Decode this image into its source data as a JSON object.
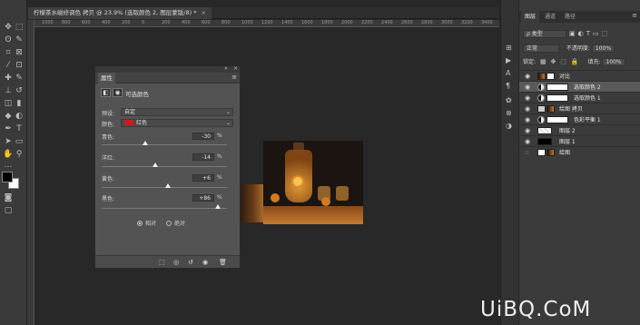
{
  "document": {
    "tab_title": "柠檬茶水磁修调色 拷贝 @ 23.9% (选取颜色 2, 图层蒙版/8) *",
    "close_glyph": "×"
  },
  "ruler": {
    "ticks": [
      "1000",
      "800",
      "600",
      "400",
      "200",
      "0",
      "200",
      "400",
      "600",
      "800",
      "1000",
      "1200",
      "1400",
      "1600",
      "1800",
      "2000",
      "2200",
      "2400",
      "2600",
      "2800",
      "3000",
      "3200",
      "3400",
      "3600"
    ]
  },
  "properties": {
    "tab_label": "属性",
    "menu_glyph": "≡",
    "collapse_glyph": "«",
    "close_glyph": "×",
    "title": "可选颜色",
    "preset_label": "预设:",
    "preset_value": "自定",
    "colors_label": "颜色:",
    "colors_value": "红色",
    "colors_swatch": "#c61d1d",
    "sliders": [
      {
        "label": "青色:",
        "value": "-30",
        "unit": "%",
        "level": -30
      },
      {
        "label": "洋红:",
        "value": "-14",
        "unit": "%",
        "level": -14
      },
      {
        "label": "黄色:",
        "value": "+6",
        "unit": "%",
        "level": 6
      },
      {
        "label": "黑色:",
        "value": "+86",
        "unit": "%",
        "level": 86
      }
    ],
    "method_relative": "相对",
    "method_absolute": "绝对",
    "method_selected": "相对"
  },
  "layers_panel": {
    "tabs": [
      "图层",
      "通道",
      "路径"
    ],
    "active_tab": "图层",
    "menu_glyph": "≡",
    "filter_label": "ρ 类型",
    "blend_mode": "正常",
    "opacity_label": "不透明度:",
    "opacity_value": "100%",
    "lock_label": "锁定:",
    "fill_label": "填充:",
    "fill_value": "100%",
    "layers": [
      {
        "name": "对比",
        "type": "image",
        "selected": false
      },
      {
        "name": "选取颜色 2",
        "type": "adjustment",
        "selected": true
      },
      {
        "name": "选取颜色 1",
        "type": "adjustment",
        "selected": false
      },
      {
        "name": "给图 拷贝",
        "type": "image",
        "selected": false
      },
      {
        "name": "色彩平衡 1",
        "type": "adjustment",
        "selected": false
      },
      {
        "name": "图层 2",
        "type": "checker",
        "selected": false
      },
      {
        "name": "图层 1",
        "type": "black",
        "selected": false
      },
      {
        "name": "给图",
        "type": "image",
        "selected": false
      }
    ]
  },
  "watermark": "UiBQ.CoM"
}
